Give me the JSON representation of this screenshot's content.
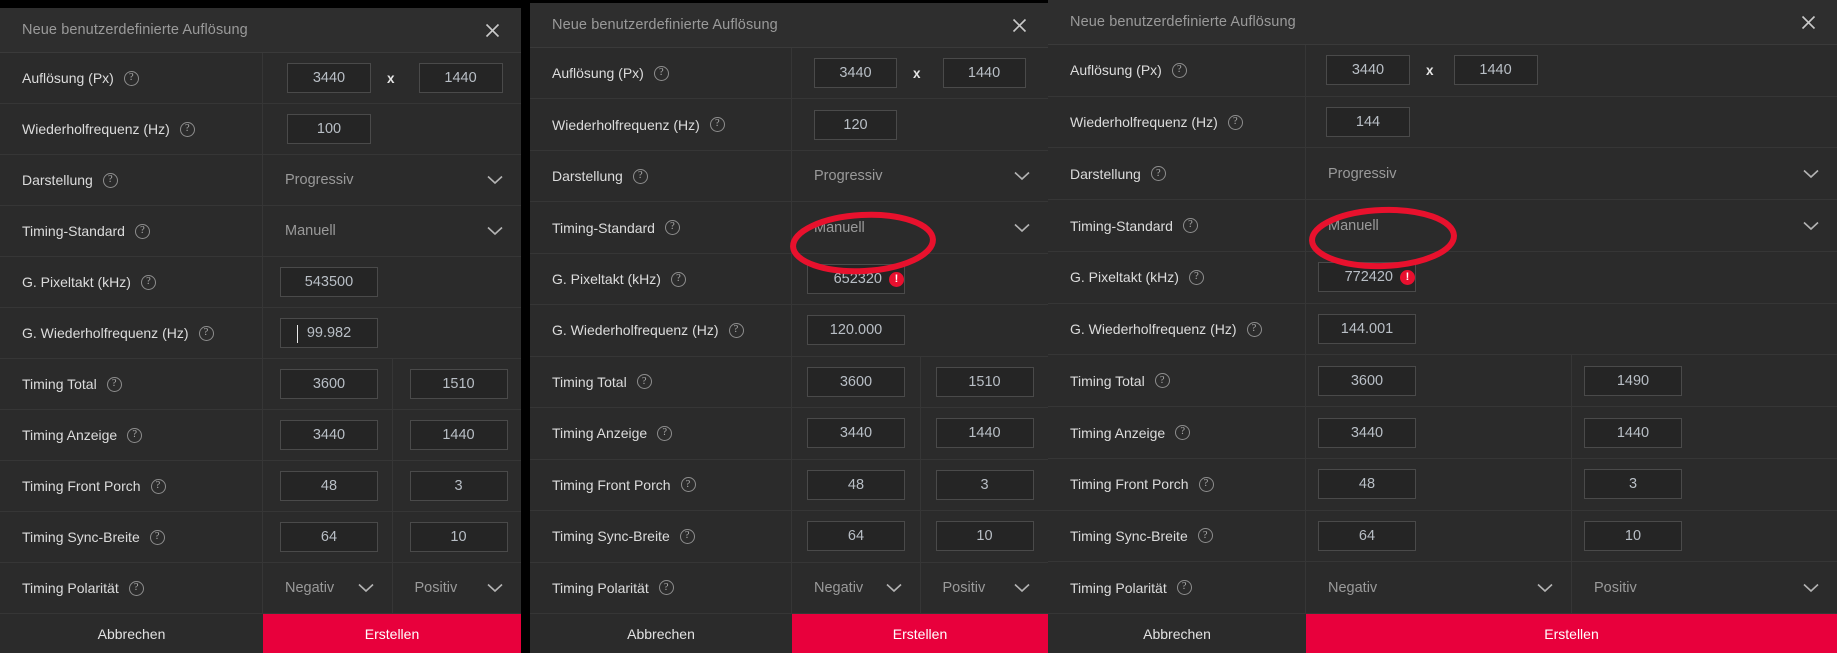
{
  "dialog_title": "Neue benutzerdefinierte Auflösung",
  "icons": {
    "close": "close-icon",
    "help": "?",
    "error": "!",
    "chevron_down": "chevron-down-icon"
  },
  "labels": {
    "resolution": "Auflösung (Px)",
    "refresh_rate": "Wiederholfrequenz (Hz)",
    "presentation": "Darstellung",
    "timing_standard": "Timing-Standard",
    "pixel_clock": "G. Pixeltakt (kHz)",
    "g_refresh_rate": "G. Wiederholfrequenz (Hz)",
    "timing_total": "Timing Total",
    "timing_display": "Timing Anzeige",
    "timing_front_porch": "Timing Front Porch",
    "timing_sync_width": "Timing Sync-Breite",
    "timing_polarity": "Timing Polarität"
  },
  "buttons": {
    "cancel": "Abbrechen",
    "create": "Erstellen"
  },
  "separator_x": "x",
  "colors": {
    "accent_red": "#e8003c",
    "error_red": "#e8102f",
    "annotation_red": "#e8112d",
    "panel_bg": "#2b2b2b",
    "field_bg": "#252525"
  },
  "panels": [
    {
      "id": "panel1",
      "title": "Neue benutzerdefinierte Auflösung",
      "resolution_w": "3440",
      "resolution_h": "1440",
      "refresh_rate": "100",
      "presentation": "Progressiv",
      "timing_standard": "Manuell",
      "pixel_clock": "543500",
      "pixel_clock_error": false,
      "g_refresh_rate": "99.982",
      "g_refresh_focused": true,
      "timing_total_h": "3600",
      "timing_total_v": "1510",
      "timing_display_h": "3440",
      "timing_display_v": "1440",
      "front_porch_h": "48",
      "front_porch_v": "3",
      "sync_width_h": "64",
      "sync_width_v": "10",
      "polarity_h": "Negativ",
      "polarity_v": "Positiv"
    },
    {
      "id": "panel2",
      "title": "Neue benutzerdefinierte Auflösung",
      "resolution_w": "3440",
      "resolution_h": "1440",
      "refresh_rate": "120",
      "presentation": "Progressiv",
      "timing_standard": "Manuell",
      "pixel_clock": "652320",
      "pixel_clock_error": true,
      "g_refresh_rate": "120.000",
      "g_refresh_focused": false,
      "timing_total_h": "3600",
      "timing_total_v": "1510",
      "timing_display_h": "3440",
      "timing_display_v": "1440",
      "front_porch_h": "48",
      "front_porch_v": "3",
      "sync_width_h": "64",
      "sync_width_v": "10",
      "polarity_h": "Negativ",
      "polarity_v": "Positiv"
    },
    {
      "id": "panel3",
      "title": "Neue benutzerdefinierte Auflösung",
      "resolution_w": "3440",
      "resolution_h": "1440",
      "refresh_rate": "144",
      "presentation": "Progressiv",
      "timing_standard": "Manuell",
      "pixel_clock": "772420",
      "pixel_clock_error": true,
      "g_refresh_rate": "144.001",
      "g_refresh_focused": false,
      "timing_total_h": "3600",
      "timing_total_v": "1490",
      "timing_display_h": "3440",
      "timing_display_v": "1440",
      "front_porch_h": "48",
      "front_porch_v": "3",
      "sync_width_h": "64",
      "sync_width_v": "10",
      "polarity_h": "Negativ",
      "polarity_v": "Positiv"
    }
  ]
}
